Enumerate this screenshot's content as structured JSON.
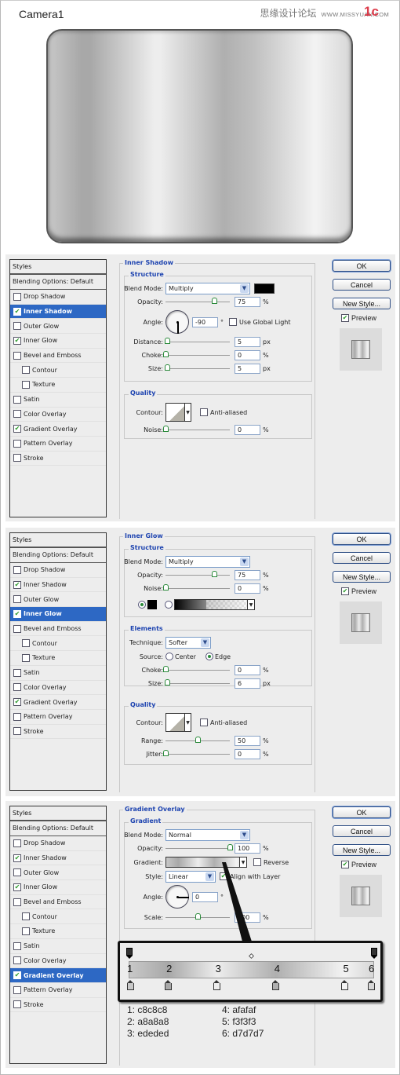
{
  "header": {
    "title": "Camera1",
    "watermark_cn": "思缘设计论坛",
    "watermark_site": "WWW.MISSYUAN.COM",
    "step_badge": "1c"
  },
  "camera_preview": {
    "gradient_stops": [
      "#c8c8c8",
      "#a8a8a8",
      "#ededed",
      "#afafaf",
      "#f3f3f3",
      "#d7d7d7"
    ]
  },
  "styles_list": {
    "header": "Styles",
    "blending": "Blending Options: Default",
    "items": [
      {
        "label": "Drop Shadow",
        "indent": false
      },
      {
        "label": "Inner Shadow",
        "indent": false
      },
      {
        "label": "Outer Glow",
        "indent": false
      },
      {
        "label": "Inner Glow",
        "indent": false
      },
      {
        "label": "Bevel and Emboss",
        "indent": false
      },
      {
        "label": "Contour",
        "indent": true
      },
      {
        "label": "Texture",
        "indent": true
      },
      {
        "label": "Satin",
        "indent": false
      },
      {
        "label": "Color Overlay",
        "indent": false
      },
      {
        "label": "Gradient Overlay",
        "indent": false
      },
      {
        "label": "Pattern Overlay",
        "indent": false
      },
      {
        "label": "Stroke",
        "indent": false
      }
    ],
    "checked": [
      "Inner Shadow",
      "Inner Glow",
      "Gradient Overlay"
    ]
  },
  "buttons": {
    "ok": "OK",
    "cancel": "Cancel",
    "new_style": "New Style...",
    "preview": "Preview",
    "preview_checked": true
  },
  "panels": [
    {
      "selected": "Inner Shadow",
      "title": "Inner Shadow",
      "structure": {
        "legend": "Structure",
        "blend_mode_label": "Blend Mode:",
        "blend_mode": "Multiply",
        "color": "#000000",
        "opacity_label": "Opacity:",
        "opacity": "75",
        "opacity_unit": "%",
        "angle_label": "Angle:",
        "angle": "-90",
        "angle_unit": "°",
        "global_light_label": "Use Global Light",
        "global_light": false,
        "distance_label": "Distance:",
        "distance": "5",
        "distance_unit": "px",
        "choke_label": "Choke:",
        "choke": "0",
        "choke_unit": "%",
        "size_label": "Size:",
        "size": "5",
        "size_unit": "px"
      },
      "quality": {
        "legend": "Quality",
        "contour_label": "Contour:",
        "anti_aliased_label": "Anti-aliased",
        "anti_aliased": false,
        "noise_label": "Noise:",
        "noise": "0",
        "noise_unit": "%"
      }
    },
    {
      "selected": "Inner Glow",
      "title": "Inner Glow",
      "structure": {
        "legend": "Structure",
        "blend_mode_label": "Blend Mode:",
        "blend_mode": "Multiply",
        "opacity_label": "Opacity:",
        "opacity": "75",
        "opacity_unit": "%",
        "noise_label": "Noise:",
        "noise": "0",
        "noise_unit": "%",
        "fill_type": "color",
        "color": "#000000"
      },
      "elements": {
        "legend": "Elements",
        "technique_label": "Technique:",
        "technique": "Softer",
        "source_label": "Source:",
        "source_center": "Center",
        "source_edge": "Edge",
        "source": "Edge",
        "choke_label": "Choke:",
        "choke": "0",
        "choke_unit": "%",
        "size_label": "Size:",
        "size": "6",
        "size_unit": "px"
      },
      "quality": {
        "legend": "Quality",
        "contour_label": "Contour:",
        "anti_aliased_label": "Anti-aliased",
        "anti_aliased": false,
        "range_label": "Range:",
        "range": "50",
        "range_unit": "%",
        "jitter_label": "Jitter:",
        "jitter": "0",
        "jitter_unit": "%"
      }
    },
    {
      "selected": "Gradient Overlay",
      "title": "Gradient Overlay",
      "gradient": {
        "legend": "Gradient",
        "blend_mode_label": "Blend Mode:",
        "blend_mode": "Normal",
        "opacity_label": "Opacity:",
        "opacity": "100",
        "opacity_unit": "%",
        "gradient_label": "Gradient:",
        "reverse_label": "Reverse",
        "reverse": false,
        "style_label": "Style:",
        "style": "Linear",
        "align_label": "Align with Layer",
        "align": true,
        "angle_label": "Angle:",
        "angle": "0",
        "angle_unit": "°",
        "scale_label": "Scale:",
        "scale": "100",
        "scale_unit": "%"
      }
    }
  ],
  "gradient_editor": {
    "stops": [
      {
        "num": "1",
        "color": "c8c8c8",
        "location_pct": 0
      },
      {
        "num": "2",
        "color": "a8a8a8",
        "location_pct": 16
      },
      {
        "num": "3",
        "color": "ededed",
        "location_pct": 36
      },
      {
        "num": "4",
        "color": "afafaf",
        "location_pct": 60
      },
      {
        "num": "5",
        "color": "f3f3f3",
        "location_pct": 88
      },
      {
        "num": "6",
        "color": "d7d7d7",
        "location_pct": 100
      }
    ],
    "codes": [
      "1: c8c8c8",
      "2: a8a8a8",
      "3: ededed",
      "4: afafaf",
      "5: f3f3f3",
      "6: d7d7d7"
    ]
  },
  "slider_values": {
    "p1_opacity": 75,
    "p1_distance": 5,
    "p1_choke": 0,
    "p1_size": 5,
    "p1_noise": 0,
    "p2_opacity": 75,
    "p2_noise": 0,
    "p2_choke": 0,
    "p2_size": 6,
    "p2_range": 50,
    "p2_jitter": 0,
    "p3_opacity": 100,
    "p3_scale": 50
  },
  "colors": {
    "selection": "#2d68c4",
    "legend": "#1e44b0",
    "check": "#2a9a2a"
  }
}
